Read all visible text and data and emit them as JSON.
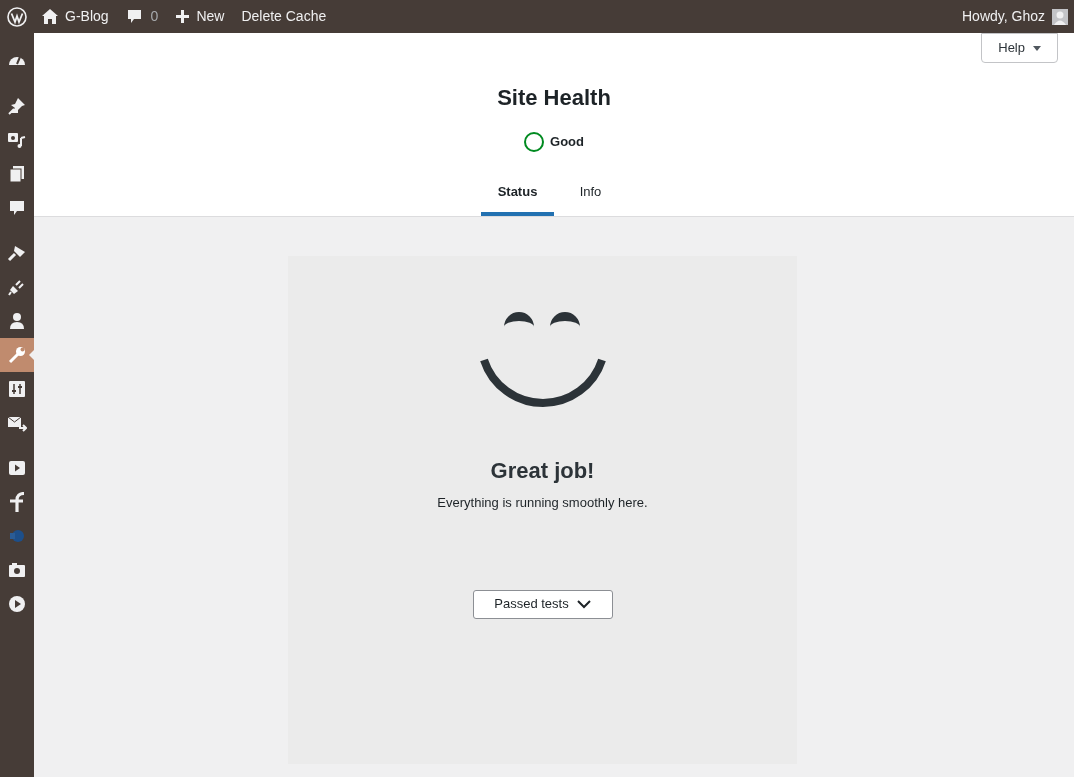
{
  "admin_bar": {
    "site_name": "G-Blog",
    "comment_count": "0",
    "new_label": "New",
    "delete_cache_label": "Delete Cache",
    "greeting": "Howdy, Ghoz"
  },
  "sidebar": {
    "groups": [
      {
        "items": [
          {
            "kind": "dashboard",
            "selected": false
          }
        ]
      },
      {
        "items": [
          {
            "kind": "pin",
            "selected": false
          },
          {
            "kind": "media",
            "selected": false
          },
          {
            "kind": "pages",
            "selected": false
          },
          {
            "kind": "comments",
            "selected": false
          }
        ]
      },
      {
        "items": [
          {
            "kind": "brush",
            "selected": false
          },
          {
            "kind": "plug",
            "selected": false
          },
          {
            "kind": "user",
            "selected": false
          },
          {
            "kind": "wrench",
            "selected": true
          },
          {
            "kind": "sliders",
            "selected": false
          },
          {
            "kind": "mail",
            "selected": false
          }
        ]
      },
      {
        "items": [
          {
            "kind": "video",
            "selected": false
          },
          {
            "kind": "facebook",
            "selected": false
          },
          {
            "kind": "globe",
            "selected": false
          },
          {
            "kind": "camera",
            "selected": false
          },
          {
            "kind": "play",
            "selected": false
          }
        ]
      }
    ]
  },
  "help_button": "Help",
  "page_title": "Site Health",
  "health_status": {
    "label": "Good",
    "color": "#008a20"
  },
  "tabs": [
    {
      "label": "Status",
      "selected": true
    },
    {
      "label": "Info",
      "selected": false
    }
  ],
  "result": {
    "title": "Great job!",
    "message": "Everything is running smoothly here.",
    "passed_tests_button": "Passed tests"
  }
}
